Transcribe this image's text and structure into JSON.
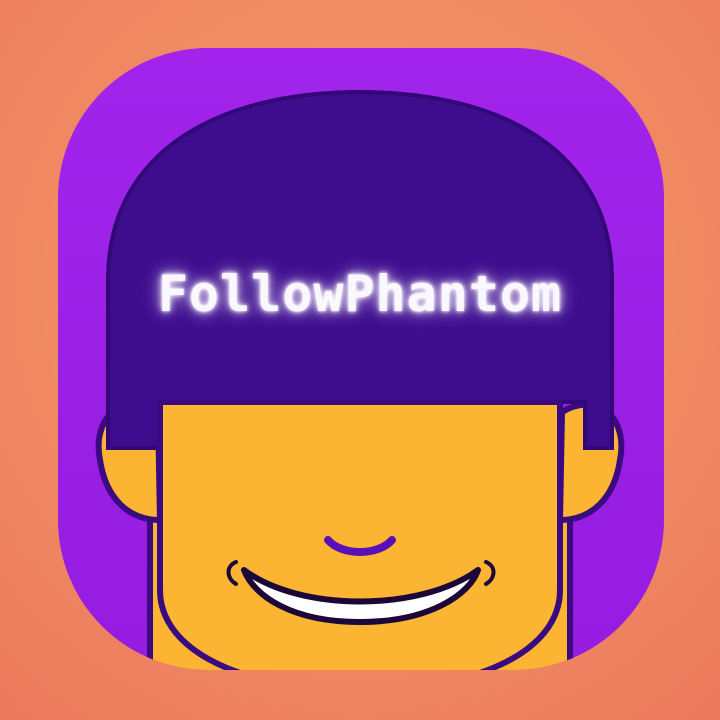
{
  "app_icon": {
    "title": "FollowPhantom",
    "colors": {
      "background": "#f08a63",
      "tile": "#9b20e6",
      "hair": "#3e0d8e",
      "face": "#fbb532",
      "outline": "#3a0a80",
      "glow_text": "#fbf7ff"
    },
    "icon_names": [
      "face-icon",
      "smile-icon"
    ]
  }
}
